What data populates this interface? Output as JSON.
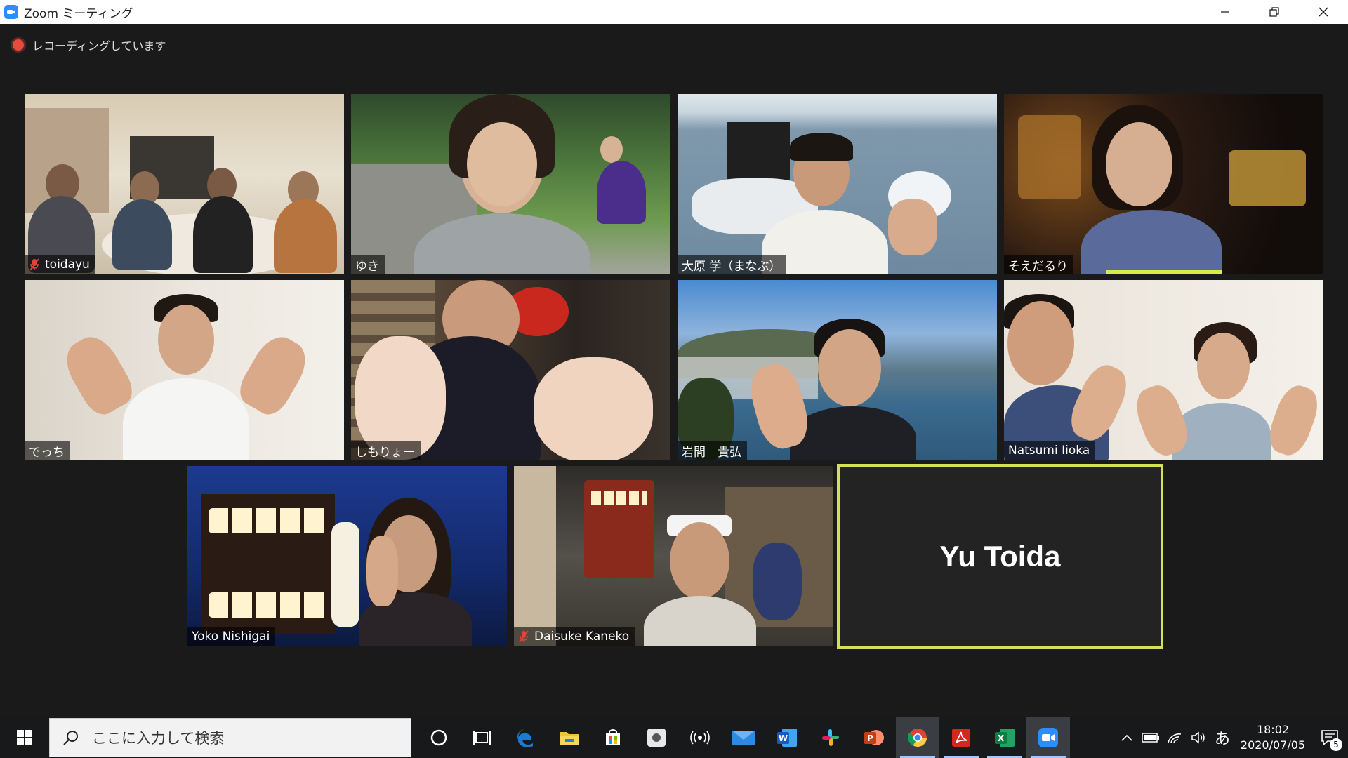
{
  "window": {
    "title": "Zoom ミーティング"
  },
  "recording": {
    "label": "レコーディングしています",
    "color": "#e84a3b"
  },
  "participants": [
    {
      "name": "toidayu",
      "muted": true
    },
    {
      "name": "ゆき",
      "muted": false
    },
    {
      "name": "大原 学（まなぶ）",
      "muted": false
    },
    {
      "name": "そえだるり",
      "muted": false,
      "speaking": true
    },
    {
      "name": "でっち",
      "muted": false
    },
    {
      "name": "しもりょー",
      "muted": false
    },
    {
      "name": "岩間　貴弘",
      "muted": false
    },
    {
      "name": "Natsumi Iioka",
      "muted": false
    },
    {
      "name": "Yoko Nishigai",
      "muted": false
    },
    {
      "name": "Daisuke Kaneko",
      "muted": true
    },
    {
      "name": "Yu Toida",
      "muted": false,
      "video_off": true
    }
  ],
  "taskbar": {
    "search_placeholder": "ここに入力して検索",
    "apps": [
      "cortana-icon",
      "task-view-icon",
      "edge-icon",
      "file-explorer-icon",
      "store-icon",
      "app-icon",
      "podcast-icon",
      "mail-icon",
      "word-icon",
      "slack-icon",
      "powerpoint-icon",
      "chrome-icon",
      "acrobat-icon",
      "excel-icon",
      "zoom-icon"
    ],
    "ime": "あ",
    "time": "18:02",
    "date": "2020/07/05",
    "notifications": "5"
  },
  "colors": {
    "accent": "#2d8cff",
    "active_speaker": "#d4e05a"
  }
}
